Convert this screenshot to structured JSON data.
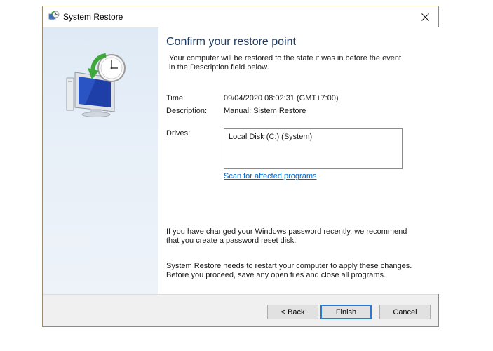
{
  "window": {
    "title": "System Restore",
    "title_icon": "system-restore-icon",
    "close_icon": "close-icon"
  },
  "side_panel": {
    "illustration": "monitor-with-clock-restore-icon"
  },
  "content": {
    "heading": "Confirm your restore point",
    "intro_line1": "Your computer will be restored to the state it was in before the event",
    "intro_line2": "in the Description field below.",
    "fields": {
      "time_label": "Time:",
      "time_value": "09/04/2020 08:02:31 (GMT+7:00)",
      "description_label": "Description:",
      "description_value": "Manual: Sistem Restore",
      "drives_label": "Drives:"
    },
    "drives": [
      "Local Disk (C:) (System)"
    ],
    "scan_link": "Scan for affected programs",
    "password_note_line1": "If you have changed your Windows password recently, we recommend",
    "password_note_line2": "that you create a password reset disk.",
    "restart_note_line1": "System Restore needs to restart your computer to apply these changes.",
    "restart_note_line2": "Before you proceed, save any open files and close all programs."
  },
  "footer": {
    "back_label": "< Back",
    "finish_label": "Finish",
    "cancel_label": "Cancel"
  },
  "colors": {
    "heading": "#1e3a5f",
    "link": "#0066cc",
    "default_button_border": "#2a7ad5",
    "side_panel": "#e4edf7",
    "footer": "#f0f0f0"
  }
}
